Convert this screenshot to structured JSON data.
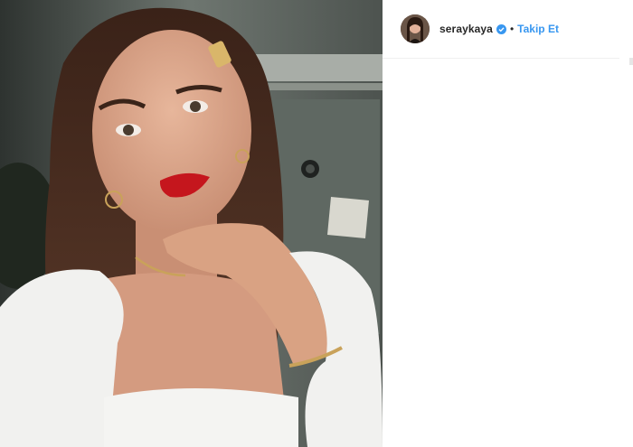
{
  "post": {
    "image_icon": "selfie-photo"
  },
  "header": {
    "avatar_icon": "profile-avatar",
    "username": "seraykaya",
    "verified_icon": "verified-badge-icon",
    "separator": "•",
    "follow_label": "Takip Et"
  },
  "colors": {
    "follow_blue": "#3897f0",
    "verified_blue": "#3897f0",
    "text": "#262626",
    "divider": "#efefef"
  }
}
